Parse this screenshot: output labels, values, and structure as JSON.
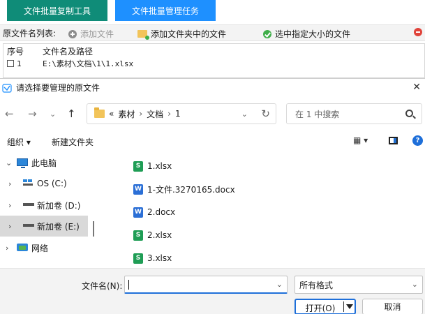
{
  "app": {
    "tabs": [
      {
        "label": "文件批量复制工具"
      },
      {
        "label": "文件批量管理任务"
      }
    ],
    "toolbar": {
      "list_label": "原文件名列表:",
      "add_file": "添加文件",
      "add_folder_files": "添加文件夹中的文件",
      "select_by_size": "选中指定大小的文件"
    },
    "table": {
      "headers": [
        "序号",
        "文件名及路径"
      ],
      "rows": [
        {
          "index": "1",
          "path": "E:\\素材\\文档\\1\\1.xlsx"
        }
      ]
    }
  },
  "dialog": {
    "title": "请选择要管理的原文件",
    "address": {
      "overflow": "«",
      "segments": [
        "素材",
        "文档",
        "1"
      ]
    },
    "search_placeholder": "在 1 中搜索",
    "commands": {
      "organize": "组织 ▾",
      "new_folder": "新建文件夹",
      "view": "▦ ▾"
    },
    "nav": [
      {
        "label": "此电脑",
        "chevron": "⌄"
      },
      {
        "label": "OS (C:)",
        "chevron": "›"
      },
      {
        "label": "新加卷 (D:)",
        "chevron": "›"
      },
      {
        "label": "新加卷 (E:)",
        "chevron": "›"
      },
      {
        "label": "网络",
        "chevron": "›"
      }
    ],
    "files": [
      {
        "name": "1.xlsx",
        "type": "xlsx",
        "badge": "S"
      },
      {
        "name": "1-文件.3270165.docx",
        "type": "docx",
        "badge": "W"
      },
      {
        "name": "2.docx",
        "type": "docx",
        "badge": "W"
      },
      {
        "name": "2.xlsx",
        "type": "xlsx",
        "badge": "S"
      },
      {
        "name": "3.xlsx",
        "type": "xlsx",
        "badge": "S"
      }
    ],
    "footer": {
      "filename_label": "文件名(N):",
      "filename_value": "",
      "filter_value": "所有格式",
      "open_label": "打开(O)",
      "cancel_label": "取消"
    }
  },
  "colors": {
    "tab_active_green": "#0f8c78",
    "tab_blue": "#1e90ff",
    "accent": "#1e6fd9",
    "xlsx": "#1f9d55",
    "docx": "#2b6fd6"
  }
}
